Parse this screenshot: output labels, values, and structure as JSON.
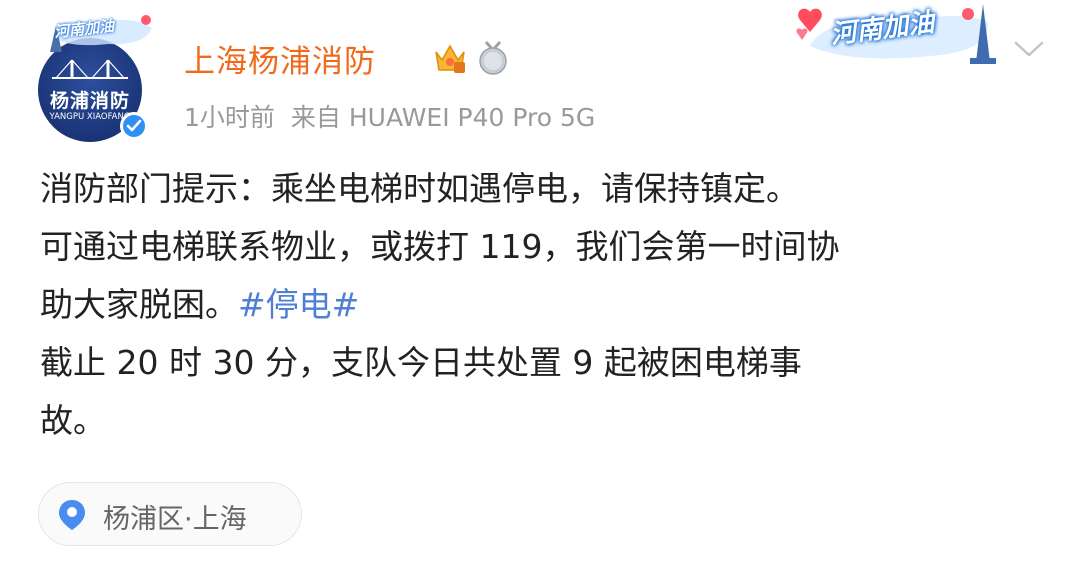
{
  "post": {
    "username": "上海杨浦消防",
    "time": "1小时前",
    "source_prefix": "来自",
    "source_device": "HUAWEI P40 Pro 5G",
    "avatar": {
      "name": "杨浦消防",
      "subtitle": "YANGPU XIAOFANG",
      "frame_text": "河南加油"
    },
    "right_banner_text": "河南加油",
    "content": {
      "line1": "消防部门提示：乘坐电梯时如遇停电，请保持镇定。",
      "line2": "可通过电梯联系物业，或拨打 119，我们会第一时间协",
      "line3_text": "助大家脱困。",
      "topic": "#停电#",
      "line4": "截止 20 时 30 分，支队今日共处置 9 起被困电梯事",
      "line5": "故。"
    },
    "location": "杨浦区·上海",
    "icons": {
      "verified": "verified-icon",
      "crown": "crown-badge-icon",
      "medal": "medal-badge-icon",
      "chevron": "chevron-down-icon",
      "location": "location-pin-icon"
    },
    "colors": {
      "username": "#ef6b1b",
      "topic": "#4f7fd4",
      "meta": "#999999",
      "verified": "#2f8ff2"
    }
  }
}
